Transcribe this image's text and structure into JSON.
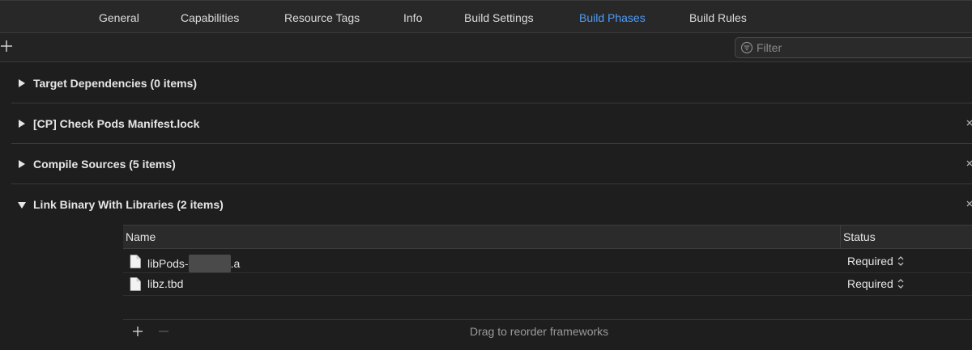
{
  "tabs": [
    {
      "label": "General",
      "active": false
    },
    {
      "label": "Capabilities",
      "active": false
    },
    {
      "label": "Resource Tags",
      "active": false
    },
    {
      "label": "Info",
      "active": false
    },
    {
      "label": "Build Settings",
      "active": false
    },
    {
      "label": "Build Phases",
      "active": true
    },
    {
      "label": "Build Rules",
      "active": false
    }
  ],
  "filter": {
    "placeholder": "Filter",
    "value": "",
    "icon": "filter-icon"
  },
  "phases": [
    {
      "title": "Target Dependencies (0 items)",
      "expanded": false,
      "removable": false
    },
    {
      "title": "[CP] Check Pods Manifest.lock",
      "expanded": false,
      "removable": true
    },
    {
      "title": "Compile Sources (5 items)",
      "expanded": false,
      "removable": true
    },
    {
      "title": "Link Binary With Libraries (2 items)",
      "expanded": true,
      "removable": true
    }
  ],
  "library_table": {
    "columns": {
      "name": "Name",
      "status": "Status"
    },
    "rows": [
      {
        "name_prefix": "libPods-",
        "name_suffix": ".a",
        "redacted": true,
        "status": "Required"
      },
      {
        "name_prefix": "libz.tbd",
        "name_suffix": "",
        "redacted": false,
        "status": "Required"
      }
    ],
    "footer_hint": "Drag to reorder frameworks"
  },
  "colors": {
    "background": "#1e1e1e",
    "accent": "#4f9cf7",
    "text": "#e6e6e6",
    "muted": "#9a9a9a"
  }
}
